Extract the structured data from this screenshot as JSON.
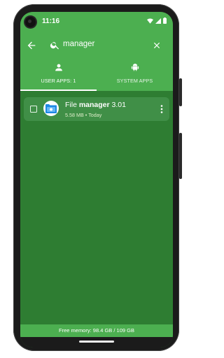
{
  "status": {
    "time": "11:16"
  },
  "search": {
    "query_prefix": "",
    "query": "manager"
  },
  "tabs": [
    {
      "label": "USER APPS: 1",
      "icon": "person-icon",
      "selected": true
    },
    {
      "label": "SYSTEM APPS",
      "icon": "android-icon",
      "selected": false
    }
  ],
  "apps": [
    {
      "name_prefix": "File ",
      "name_match": "manager",
      "name_suffix": " 3.01",
      "size": "5.58 MB",
      "separator": "•",
      "date": "Today",
      "icon": "file-manager-app-icon"
    }
  ],
  "footer": {
    "memory": "Free memory: 98.4 GB / 109 GB"
  },
  "colors": {
    "accent": "#4caf50",
    "background": "#2e7d32",
    "card": "#408f47"
  }
}
